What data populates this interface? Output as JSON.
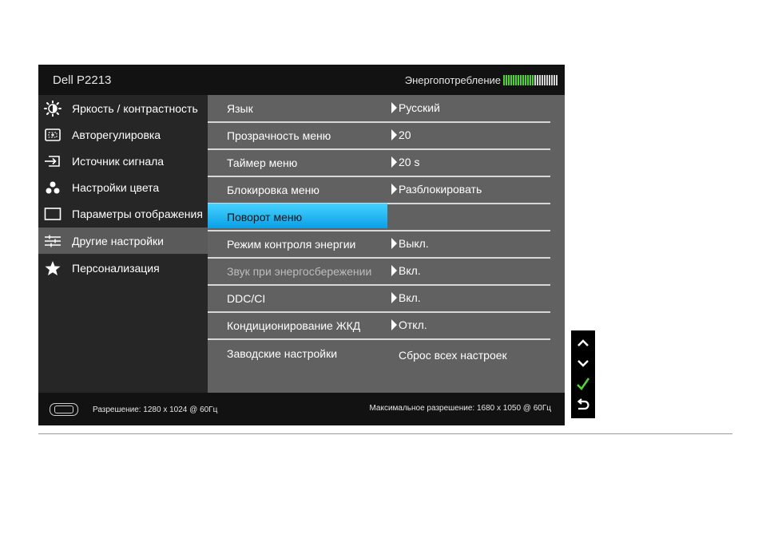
{
  "osd": {
    "model": "Dell P2213",
    "energy_label": "Энергопотребление",
    "energy_level": 0.57,
    "energy_ticks": 23,
    "colors": {
      "energy_on": "#4cd430",
      "energy_off": "#d6d6d6",
      "highlight": "#1ab4f0",
      "selected_bg": "#5a5a5a"
    }
  },
  "sidebar": {
    "items": [
      {
        "label": "Яркость / контрастность",
        "icon": "brightness-icon"
      },
      {
        "label": "Авторегулировка",
        "icon": "auto-adjust-icon"
      },
      {
        "label": "Источник сигнала",
        "icon": "input-source-icon"
      },
      {
        "label": "Настройки цвета",
        "icon": "color-settings-icon"
      },
      {
        "label": "Параметры отображения",
        "icon": "display-settings-icon"
      },
      {
        "label": "Другие настройки",
        "icon": "other-settings-icon"
      },
      {
        "label": "Персонализация",
        "icon": "star-icon"
      }
    ],
    "selected": "Другие настройки"
  },
  "settings": {
    "rows": [
      {
        "label": "Язык",
        "value": "Русский"
      },
      {
        "label": "Прозрачность меню",
        "value": "20"
      },
      {
        "label": "Таймер меню",
        "value": "20 s"
      },
      {
        "label": "Блокировка меню",
        "value": "Разблокировать"
      },
      {
        "label": "Поворот меню",
        "value": ""
      },
      {
        "label": "Режим контроля энергии",
        "value": "Выкл."
      },
      {
        "label": "Звук при энергосбережении",
        "value": "Вкл."
      },
      {
        "label": "DDC/CI",
        "value": "Вкл."
      },
      {
        "label": "Кондиционирование ЖКД",
        "value": "Откл."
      },
      {
        "label": "Заводские настройки",
        "value": "Сброс всех настроек"
      }
    ],
    "highlighted": "Поворот меню"
  },
  "status": {
    "resolution": "Разрешение: 1280 x 1024 @ 60Гц",
    "max_resolution": "Максимальное разрешение: 1680 x 1050 @ 60Гц"
  },
  "nav": {
    "icons": [
      "chevron-up-icon",
      "chevron-down-icon",
      "checkmark-icon",
      "back-icon"
    ]
  }
}
